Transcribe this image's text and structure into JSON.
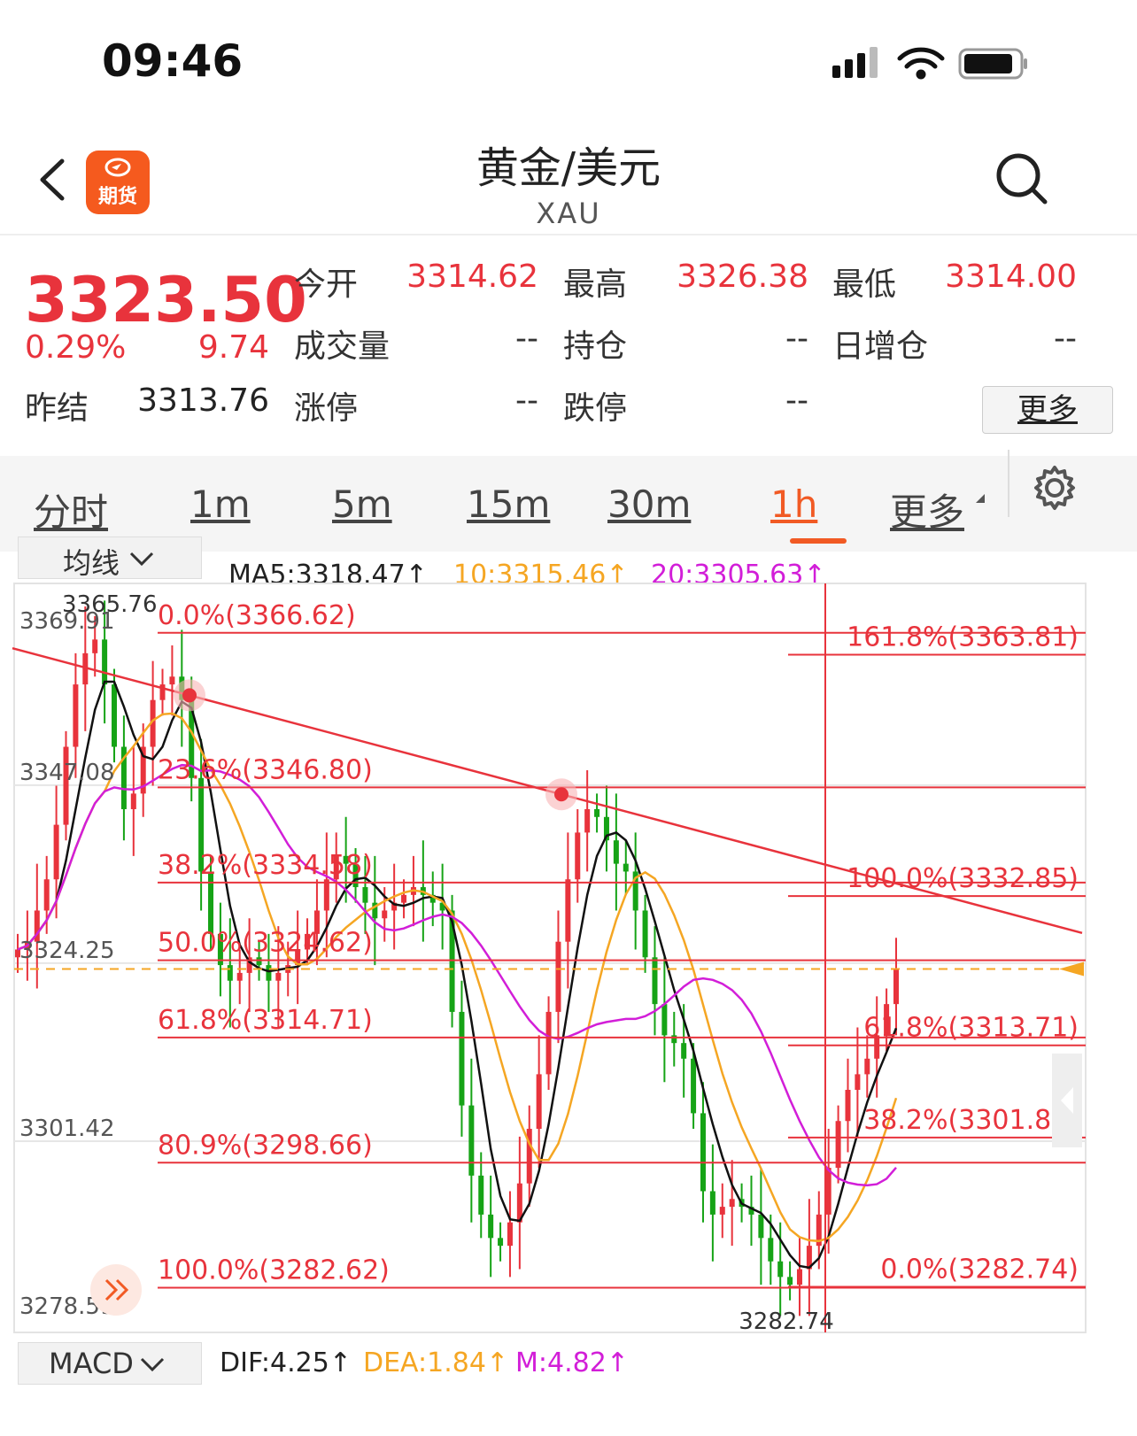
{
  "status": {
    "time": "09:46"
  },
  "nav": {
    "title": "黄金/美元",
    "subtitle": "XAU",
    "logo_text": "期货"
  },
  "quote": {
    "price": "3323.50",
    "change_pct": "0.29%",
    "change": "9.74",
    "prev_close_label": "昨结",
    "prev_close": "3313.76",
    "fields": [
      {
        "label": "今开",
        "value": "3314.62"
      },
      {
        "label": "最高",
        "value": "3326.38"
      },
      {
        "label": "最低",
        "value": "3314.00"
      },
      {
        "label": "成交量",
        "value": "--"
      },
      {
        "label": "持仓",
        "value": "--"
      },
      {
        "label": "日增仓",
        "value": "--"
      },
      {
        "label": "涨停",
        "value": "--"
      },
      {
        "label": "跌停",
        "value": "--"
      }
    ],
    "more": "更多"
  },
  "tabs": [
    {
      "label": "分时"
    },
    {
      "label": "1m"
    },
    {
      "label": "5m"
    },
    {
      "label": "15m"
    },
    {
      "label": "30m"
    },
    {
      "label": "1h",
      "active": true
    },
    {
      "label": "更多"
    }
  ],
  "indicator": {
    "ma_selector": "均线",
    "ma5": "MA5:3318.47↑",
    "ma10": "10:3315.46↑",
    "ma20": "20:3305.63↑",
    "macd_selector": "MACD",
    "dif": "DIF:4.25↑",
    "dea": "DEA:1.84↑",
    "m": "M:4.82↑"
  },
  "colors": {
    "up": "#e8333c",
    "down": "#16a316",
    "accent": "#f15a24",
    "ma5": "#111111",
    "ma10": "#f5a623",
    "ma20": "#d21ed8"
  },
  "chart_data": {
    "type": "candlestick",
    "timeframe": "1h",
    "ylim": [
      3278.59,
      3370.91
    ],
    "y_ticks": [
      "3369.91",
      "3347.08",
      "3324.25",
      "3301.42",
      "3278.59"
    ],
    "current_price": 3323.5,
    "high_label": "3365.76",
    "low_label": "3282.74",
    "fib_left": [
      {
        "label": "0.0%(3366.62)",
        "value": 3366.62
      },
      {
        "label": "23.6%(3346.80)",
        "value": 3346.8
      },
      {
        "label": "38.2%(3334.58)",
        "value": 3334.58
      },
      {
        "label": "50.0%(3324.62)",
        "value": 3324.62
      },
      {
        "label": "61.8%(3314.71)",
        "value": 3314.71
      },
      {
        "label": "80.9%(3298.66)",
        "value": 3298.66
      },
      {
        "label": "100.0%(3282.62)",
        "value": 3282.62
      }
    ],
    "fib_right": [
      {
        "label": "161.8%(3363.81)",
        "value": 3363.81
      },
      {
        "label": "100.0%(3332.85)",
        "value": 3332.85
      },
      {
        "label": "61.8%(3313.71)",
        "value": 3313.71
      },
      {
        "label": "38.2%(3301.88)",
        "value": 3301.88
      },
      {
        "label": "0.0%(3282.74)",
        "value": 3282.74
      }
    ],
    "anchors": [
      {
        "name": "peak-1",
        "value": 3358.6
      },
      {
        "name": "peak-2",
        "value": 3345.9
      }
    ],
    "close_path": [
      3326,
      3327,
      3331,
      3335,
      3342,
      3352,
      3360,
      3364,
      3365.76,
      3360,
      3352,
      3344,
      3346,
      3352,
      3358,
      3360,
      3361,
      3358,
      3348,
      3336,
      3328,
      3324,
      3322,
      3323,
      3325,
      3324,
      3322,
      3323,
      3324,
      3326,
      3328,
      3331,
      3335,
      3338,
      3337,
      3334,
      3332,
      3330,
      3331,
      3332,
      3333,
      3334,
      3333,
      3332,
      3331,
      3318,
      3306,
      3297,
      3292,
      3289,
      3288,
      3291,
      3296,
      3303,
      3310,
      3318,
      3327,
      3335,
      3341,
      3344,
      3343,
      3340,
      3337,
      3336,
      3331,
      3325,
      3319,
      3315,
      3314,
      3312,
      3305,
      3295,
      3292,
      3293,
      3294,
      3293,
      3292,
      3289,
      3286,
      3284,
      3283,
      3285,
      3288,
      3292,
      3298,
      3304,
      3308,
      3310,
      3312,
      3315,
      3319,
      3323.5
    ]
  }
}
